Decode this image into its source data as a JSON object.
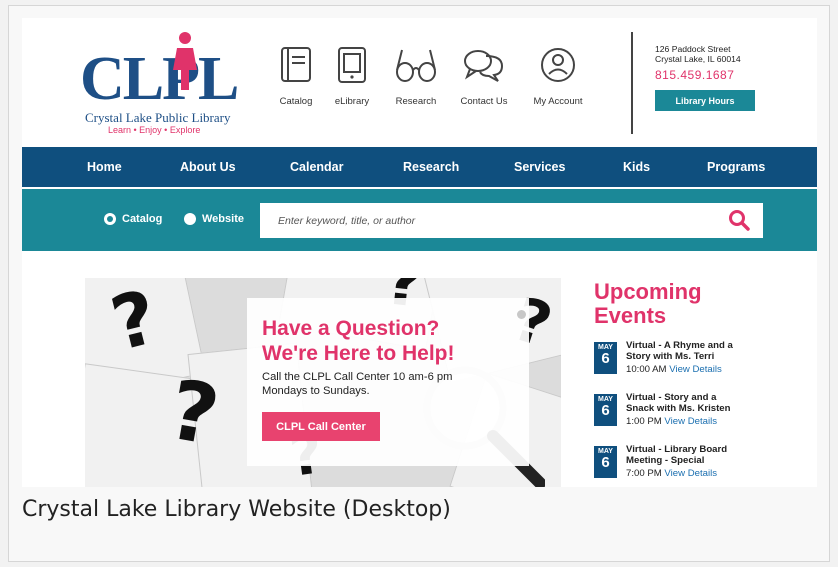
{
  "logo": {
    "mark": "CLPL",
    "name": "Crystal Lake Public Library",
    "tagline": "Learn • Enjoy • Explore"
  },
  "quick_links": [
    {
      "label": "Catalog",
      "icon": "book-icon"
    },
    {
      "label": "eLibrary",
      "icon": "tablet-icon"
    },
    {
      "label": "Research",
      "icon": "glasses-icon"
    },
    {
      "label": "Contact Us",
      "icon": "chat-bubbles-icon"
    },
    {
      "label": "My Account",
      "icon": "user-circle-icon"
    }
  ],
  "contact": {
    "address_line1": "126 Paddock Street",
    "address_line2": "Crystal Lake, IL 60014",
    "phone": "815.459.1687",
    "hours_label": "Library Hours"
  },
  "nav": [
    "Home",
    "About Us",
    "Calendar",
    "Research",
    "Services",
    "Kids",
    "Programs"
  ],
  "search": {
    "options": [
      {
        "label": "Catalog",
        "selected": true
      },
      {
        "label": "Website",
        "selected": false
      }
    ],
    "placeholder": "Enter keyword, title, or author"
  },
  "hero": {
    "title_line1": "Have a Question?",
    "title_line2": "We're Here to Help!",
    "text_line1": "Call the CLPL Call Center 10 am-6 pm",
    "text_line2": "Mondays to Sundays.",
    "button": "CLPL Call Center"
  },
  "events": {
    "title_line1": "Upcoming",
    "title_line2": "Events",
    "items": [
      {
        "month": "MAY",
        "day": "6",
        "title_line1": "Virtual - A Rhyme and a",
        "title_line2": "Story with Ms. Terri",
        "time": "10:00 AM",
        "link": "View Details"
      },
      {
        "month": "MAY",
        "day": "6",
        "title_line1": "Virtual - Story and a",
        "title_line2": "Snack with Ms. Kristen",
        "time": "1:00 PM",
        "link": "View Details"
      },
      {
        "month": "MAY",
        "day": "6",
        "title_line1": "Virtual - Library Board",
        "title_line2": "Meeting - Special",
        "time": "7:00 PM",
        "link": "View Details"
      }
    ]
  },
  "caption": "Crystal Lake Library Website (Desktop)",
  "colors": {
    "brand_blue": "#0f4f7e",
    "teal": "#1b8897",
    "pink": "#e0336a"
  }
}
